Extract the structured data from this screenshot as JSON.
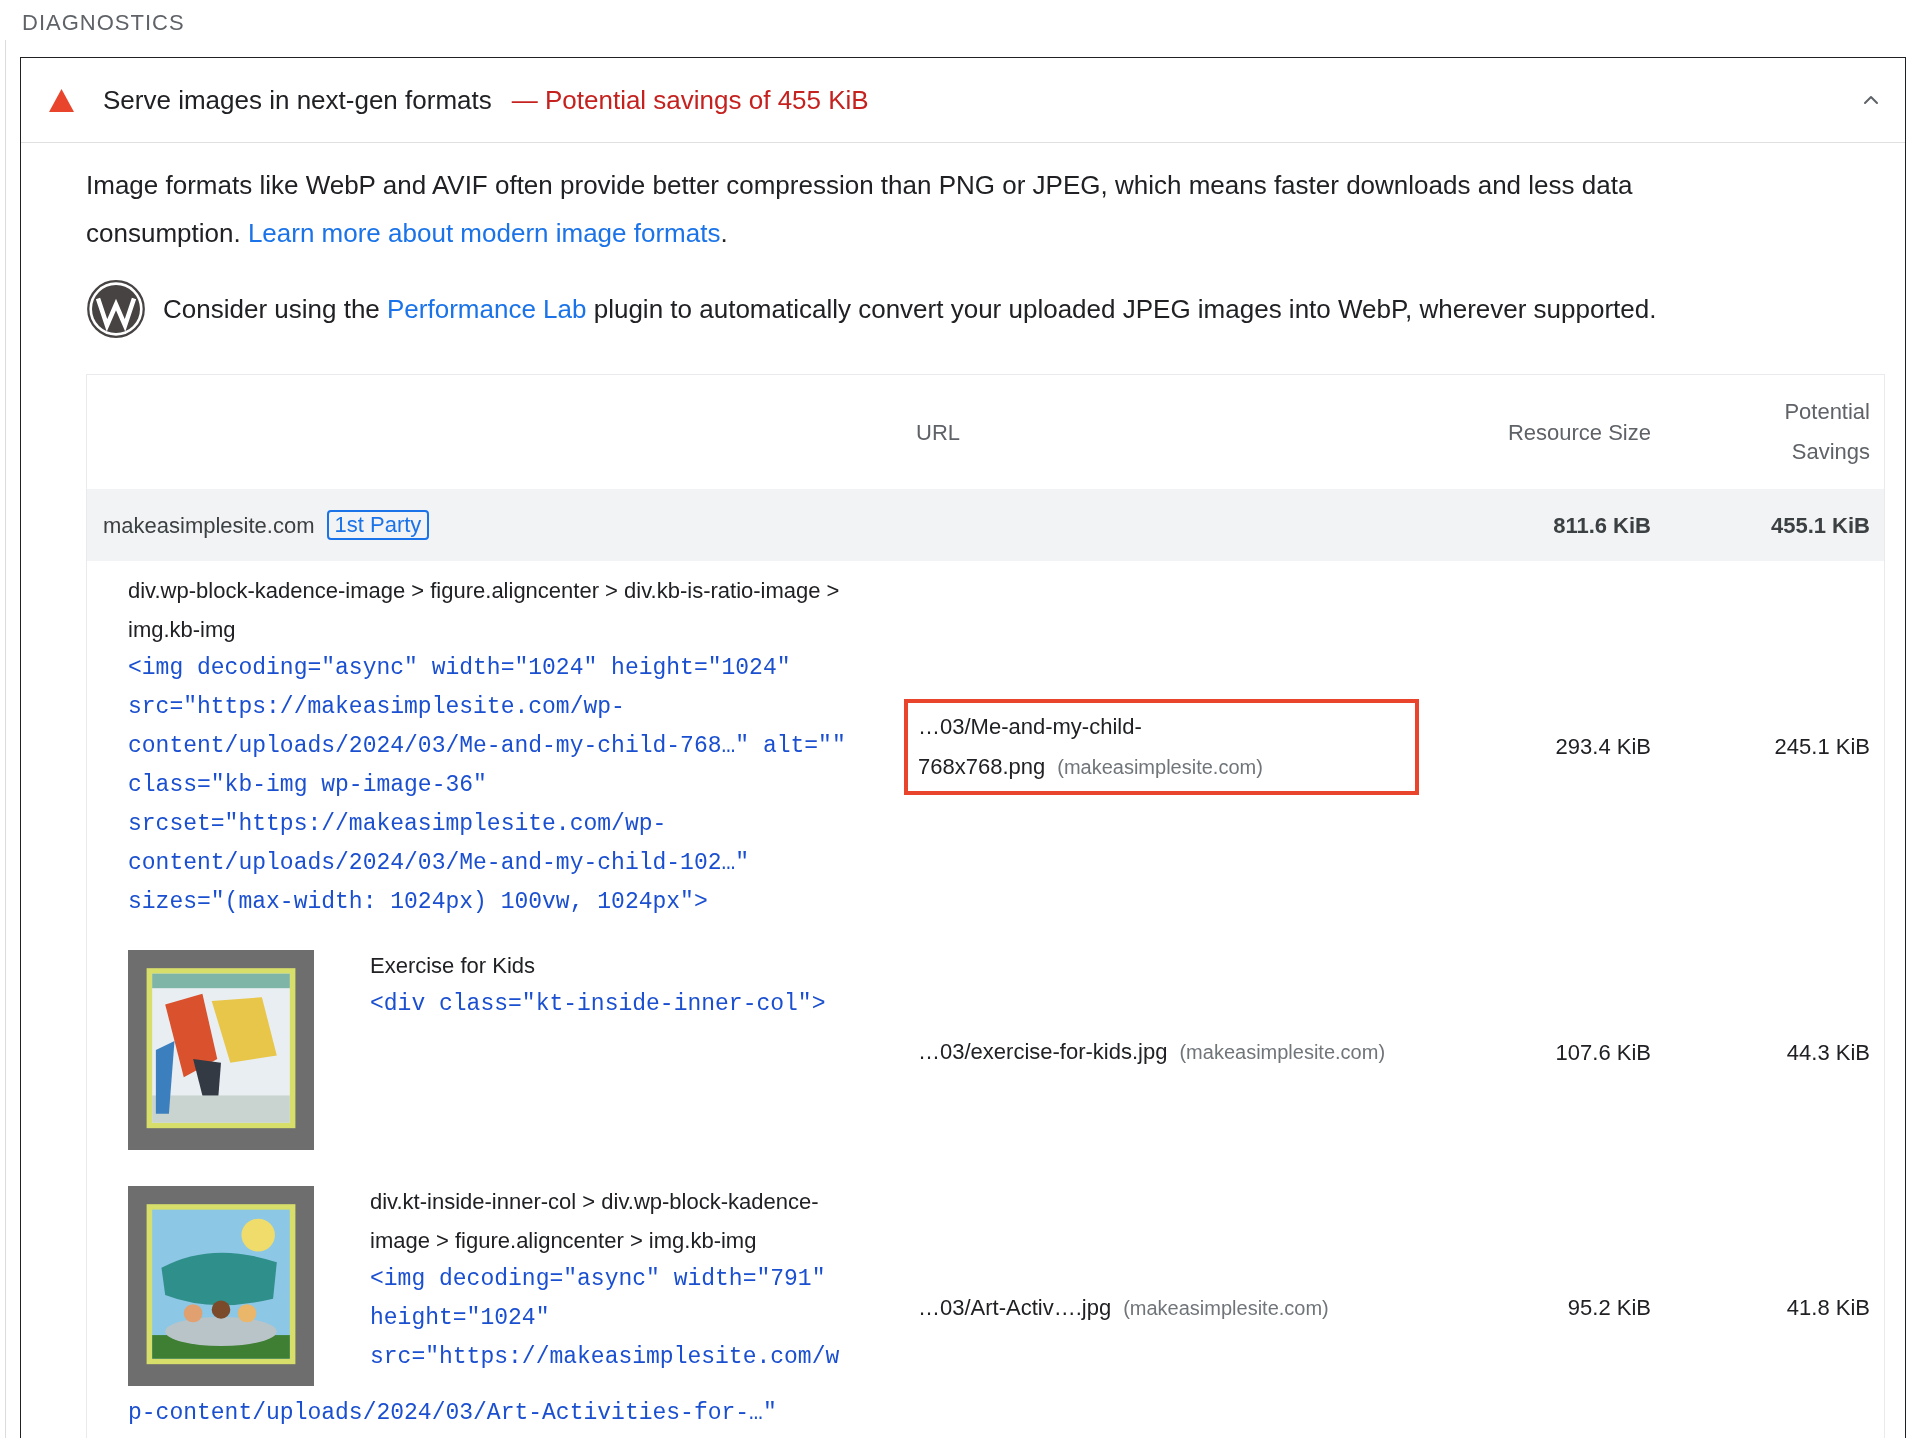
{
  "section_title": "DIAGNOSTICS",
  "audit": {
    "title": "Serve images in next-gen formats",
    "separator": "—",
    "savings": "Potential savings of 455 KiB",
    "expanded": true,
    "description": {
      "text": "Image formats like WebP and AVIF often provide better compression than PNG or JPEG, which means faster downloads and less data consumption.",
      "link": "Learn more about modern image formats",
      "after": "."
    },
    "stack_pack": {
      "before": "Consider using the",
      "link": "Performance Lab",
      "after": "plugin to automatically convert your uploaded JPEG images into WebP, wherever supported."
    }
  },
  "table": {
    "columns": [
      "URL",
      "Resource Size",
      "Potential Savings"
    ],
    "group": {
      "domain": "makeasimplesite.com",
      "badge": "1st Party",
      "size": "811.6 KiB",
      "savings": "455.1 KiB"
    },
    "rows": [
      {
        "label": "div.wp-block-kadence-image > figure.aligncenter > div.kb-is-ratio-image > img.kb-img",
        "snippet": [
          "<img decoding=\"async\" width=\"1024\" height=\"1024\"",
          "src=\"https://makeasimplesite.com/wp-",
          "content/uploads/2024/03/Me-and-my-child-768…\" alt=\"\"",
          "class=\"kb-img wp-image-36\"",
          "srcset=\"https://makeasimplesite.com/wp-",
          "content/uploads/2024/03/Me-and-my-child-102…\"",
          "sizes=\"(max-width: 1024px) 100vw, 1024px\">"
        ],
        "url": "…03/Me-and-my-child-768x768.png",
        "host": "(makeasimplesite.com)",
        "size": "293.4 KiB",
        "savings": "245.1 KiB",
        "highlighted": true
      },
      {
        "label": "Exercise for Kids",
        "snippet": [
          "<div class=\"kt-inside-inner-col\">"
        ],
        "url": "…03/exercise-for-kids.jpg",
        "host": "(makeasimplesite.com)",
        "size": "107.6 KiB",
        "savings": "44.3 KiB",
        "highlighted": false
      },
      {
        "label": "div.kt-inside-inner-col > div.wp-block-kadence-image > figure.aligncenter > img.kb-img",
        "snippet": [
          "<img decoding=\"async\" width=\"791\"",
          "height=\"1024\"",
          "src=\"https://makeasimplesite.com/w",
          "p-content/uploads/2024/03/Art-Activities-for-…\""
        ],
        "url": "…03/Art-Activ….jpg",
        "host": "(makeasimplesite.com)",
        "size": "95.2 KiB",
        "savings": "41.8 KiB",
        "highlighted": false
      }
    ]
  }
}
